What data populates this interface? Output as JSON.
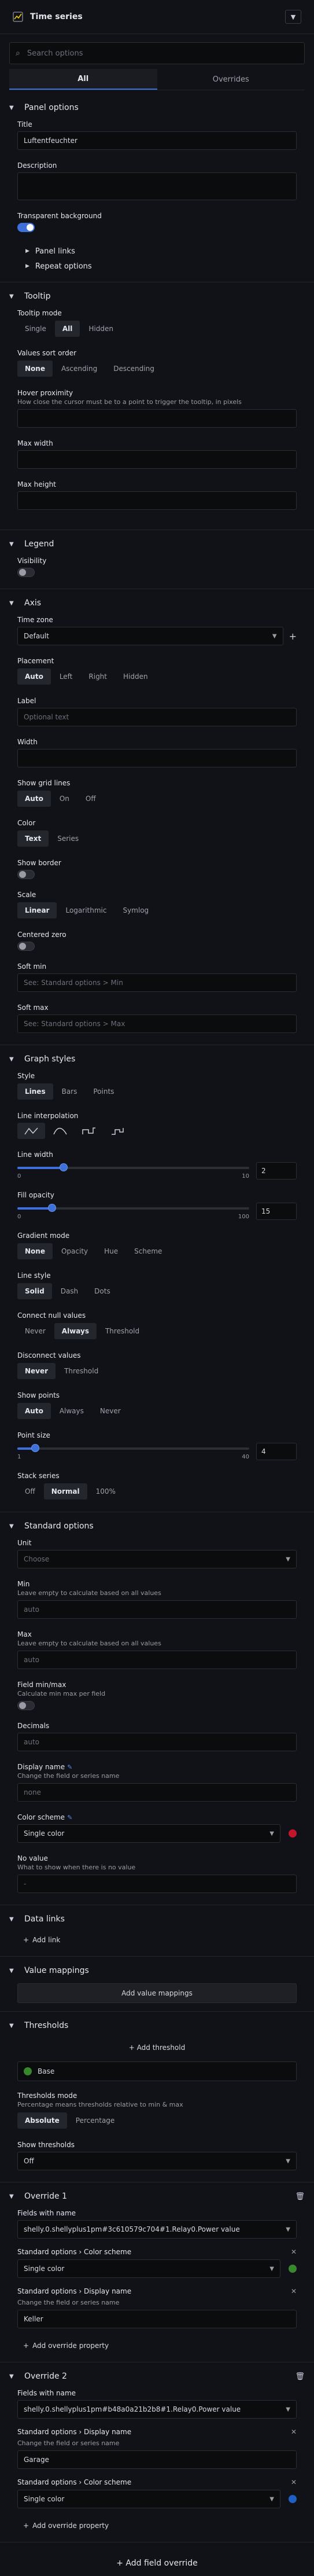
{
  "header": {
    "viz_name": "Time series"
  },
  "search": {
    "placeholder": "Search options"
  },
  "tabs": {
    "all": "All",
    "overrides": "Overrides"
  },
  "panel_options": {
    "title": "Panel options",
    "title_label": "Title",
    "title_value": "Luftentfeuchter",
    "description_label": "Description",
    "transparent_label": "Transparent background",
    "panel_links": "Panel links",
    "repeat_options": "Repeat options"
  },
  "tooltip": {
    "title": "Tooltip",
    "mode_label": "Tooltip mode",
    "modes": [
      "Single",
      "All",
      "Hidden"
    ],
    "sort_label": "Values sort order",
    "sorts": [
      "None",
      "Ascending",
      "Descending"
    ],
    "hover_label": "Hover proximity",
    "hover_desc": "How close the cursor must be to a point to trigger the tooltip, in pixels",
    "maxwidth_label": "Max width",
    "maxheight_label": "Max height"
  },
  "legend": {
    "title": "Legend",
    "visibility_label": "Visibility"
  },
  "axis": {
    "title": "Axis",
    "timezone_label": "Time zone",
    "timezone_value": "Default",
    "placement_label": "Placement",
    "placements": [
      "Auto",
      "Left",
      "Right",
      "Hidden"
    ],
    "label_label": "Label",
    "label_placeholder": "Optional text",
    "width_label": "Width",
    "grid_label": "Show grid lines",
    "grid_opts": [
      "Auto",
      "On",
      "Off"
    ],
    "color_label": "Color",
    "color_opts": [
      "Text",
      "Series"
    ],
    "border_label": "Show border",
    "scale_label": "Scale",
    "scale_opts": [
      "Linear",
      "Logarithmic",
      "Symlog"
    ],
    "centered_label": "Centered zero",
    "softmin_label": "Soft min",
    "softmin_ph": "See: Standard options > Min",
    "softmax_label": "Soft max",
    "softmax_ph": "See: Standard options > Max"
  },
  "graph": {
    "title": "Graph styles",
    "style_label": "Style",
    "style_opts": [
      "Lines",
      "Bars",
      "Points"
    ],
    "interp_label": "Line interpolation",
    "linewidth_label": "Line width",
    "linewidth_value": "2",
    "linewidth_min": "0",
    "linewidth_max": "10",
    "fill_label": "Fill opacity",
    "fill_value": "15",
    "fill_min": "0",
    "fill_max": "100",
    "gradient_label": "Gradient mode",
    "gradient_opts": [
      "None",
      "Opacity",
      "Hue",
      "Scheme"
    ],
    "linestyle_label": "Line style",
    "linestyle_opts": [
      "Solid",
      "Dash",
      "Dots"
    ],
    "connect_label": "Connect null values",
    "connect_opts": [
      "Never",
      "Always",
      "Threshold"
    ],
    "disconnect_label": "Disconnect values",
    "disconnect_opts": [
      "Never",
      "Threshold"
    ],
    "points_label": "Show points",
    "points_opts": [
      "Auto",
      "Always",
      "Never"
    ],
    "pointsize_label": "Point size",
    "pointsize_value": "4",
    "pointsize_min": "1",
    "pointsize_max": "40",
    "stack_label": "Stack series",
    "stack_opts": [
      "Off",
      "Normal",
      "100%"
    ]
  },
  "slider_levels": {
    "line_width": 0.2,
    "fill_opacity": 0.15,
    "point_size": 0.077
  },
  "standard": {
    "title": "Standard options",
    "unit_label": "Unit",
    "unit_ph": "Choose",
    "min_label": "Min",
    "min_desc": "Leave empty to calculate based on all values",
    "min_ph": "auto",
    "max_label": "Max",
    "max_desc": "Leave empty to calculate based on all values",
    "max_ph": "auto",
    "fminmax_label": "Field min/max",
    "fminmax_desc": "Calculate min max per field",
    "decimals_label": "Decimals",
    "decimals_ph": "auto",
    "display_label": "Display name",
    "display_desc": "Change the field or series name",
    "display_ph": "none",
    "scheme_label": "Color scheme",
    "scheme_value": "Single color",
    "novalue_label": "No value",
    "novalue_desc": "What to show when there is no value",
    "novalue_ph": "-"
  },
  "data_links": {
    "title": "Data links",
    "add": "Add link"
  },
  "value_mappings": {
    "title": "Value mappings",
    "add": "Add value mappings"
  },
  "thresholds": {
    "title": "Thresholds",
    "add": "Add threshold",
    "base": "Base",
    "mode_label": "Thresholds mode",
    "mode_desc": "Percentage means thresholds relative to min & max",
    "mode_opts": [
      "Absolute",
      "Percentage"
    ],
    "show_label": "Show thresholds",
    "show_value": "Off"
  },
  "override1": {
    "title": "Override 1",
    "fields_label": "Fields with name",
    "fields_value": "shelly.0.shellyplus1pm#3c610579c704#1.Relay0.Power value",
    "p1_label": "Standard options › Color scheme",
    "p1_value": "Single color",
    "p2_label": "Standard options › Display name",
    "p2_desc": "Change the field or series name",
    "p2_value": "Keller",
    "add_prop": "Add override property"
  },
  "override2": {
    "title": "Override 2",
    "fields_label": "Fields with name",
    "fields_value": "shelly.0.shellyplus1pm#b48a0a21b2b8#1.Relay0.Power value",
    "p1_label": "Standard options › Display name",
    "p1_desc": "Change the field or series name",
    "p1_value": "Garage",
    "p2_label": "Standard options › Color scheme",
    "p2_value": "Single color",
    "add_prop": "Add override property"
  },
  "add_field_override": "Add field override",
  "colors": {
    "accent": "#3d71d9",
    "red": "#c4162a",
    "green": "#37872d",
    "blue": "#1f60c4"
  }
}
